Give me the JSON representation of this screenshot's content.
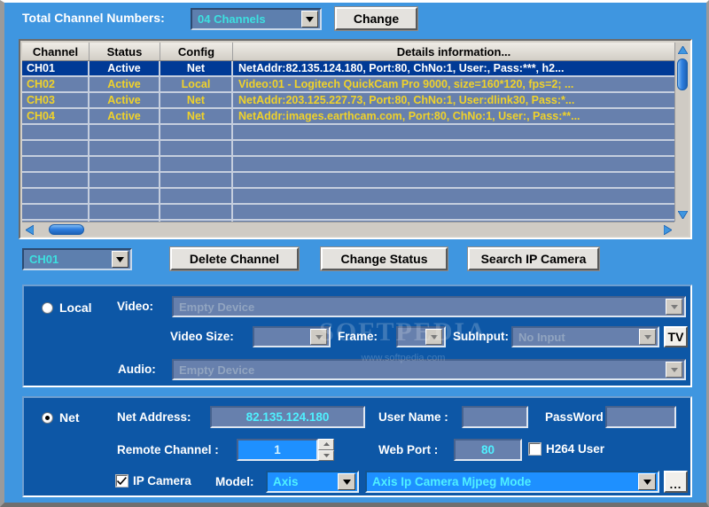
{
  "window": {
    "accent_blue": "#3f96e0",
    "panel_blue": "#0d57a6",
    "selected_row_blue": "#003a96",
    "row_text_yellow": "#f0d22a",
    "cyan_text": "#4ff0ff"
  },
  "top_bar": {
    "total_label": "Total Channel Numbers:",
    "total_value": "04 Channels",
    "change_button": "Change"
  },
  "table": {
    "headers": [
      "Channel",
      "Status",
      "Config",
      "Details information..."
    ],
    "rows": [
      {
        "channel": "CH01",
        "status": "Active",
        "config": "Net",
        "details": "NetAddr:82.135.124.180, Port:80, ChNo:1, User:, Pass:***, h2...",
        "selected": true
      },
      {
        "channel": "CH02",
        "status": "Active",
        "config": "Local",
        "details": "Video:01 - Logitech QuickCam Pro 9000, size=160*120, fps=2;  ...",
        "selected": false
      },
      {
        "channel": "CH03",
        "status": "Active",
        "config": "Net",
        "details": "NetAddr:203.125.227.73, Port:80, ChNo:1, User:dlink30, Pass:*...",
        "selected": false
      },
      {
        "channel": "CH04",
        "status": "Active",
        "config": "Net",
        "details": "NetAddr:images.earthcam.com, Port:80, ChNo:1, User:, Pass:**...",
        "selected": false
      }
    ],
    "empty_row_count": 7
  },
  "actions": {
    "channel_select_value": "CH01",
    "delete_channel": "Delete Channel",
    "change_status": "Change Status",
    "search_ip_camera": "Search IP Camera"
  },
  "local_group": {
    "radio_label": "Local",
    "radio_selected": false,
    "video_label": "Video:",
    "video_value": "Empty Device",
    "video_size_label": "Video Size:",
    "video_size_value": "",
    "frame_label": "Frame:",
    "frame_value": "",
    "subinput_label": "SubInput:",
    "subinput_value": "No Input",
    "tv_button": "TV",
    "audio_label": "Audio:",
    "audio_value": "Empty Device"
  },
  "net_group": {
    "radio_label": "Net",
    "radio_selected": true,
    "net_address_label": "Net Address:",
    "net_address_value": "82.135.124.180",
    "user_name_label": "User Name :",
    "user_name_value": "",
    "password_label": "PassWord :",
    "password_value": "",
    "remote_channel_label": "Remote Channel :",
    "remote_channel_value": "1",
    "web_port_label": "Web Port :",
    "web_port_value": "80",
    "h264_label": "H264 User",
    "h264_checked": false,
    "ip_camera_label": "IP Camera",
    "ip_camera_checked": true,
    "model_label": "Model:",
    "model_value": "Axis",
    "model_mode_value": "Axis Ip Camera Mjpeg Mode",
    "browse_button": "..."
  },
  "watermark": {
    "main": "SOFTPEDIA",
    "sub": "www.softpedia.com"
  }
}
